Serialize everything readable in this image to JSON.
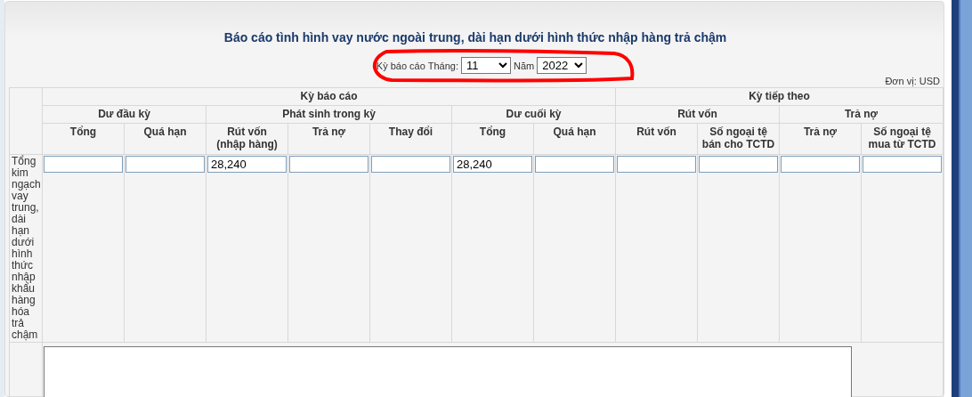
{
  "title": "Báo cáo tình hình vay nước ngoài trung, dài hạn dưới hình thức nhập hàng trả chậm",
  "period": {
    "month_label": "Kỳ báo cáo Tháng:",
    "month": "11",
    "year_label": "Năm",
    "year": "2022"
  },
  "unit": "Đơn vị: USD",
  "table": {
    "groups": [
      {
        "label": "Kỳ báo cáo",
        "subgroups": [
          {
            "label": "Dư đầu kỳ",
            "columns": [
              "Tổng",
              "Quá hạn"
            ]
          },
          {
            "label": "Phát sinh trong kỳ",
            "columns": [
              "Rút vốn\n(nhập hàng)",
              "Trả nợ",
              "Thay đổi"
            ]
          },
          {
            "label": "Dư cuối kỳ",
            "columns": [
              "Tổng",
              "Quá hạn"
            ]
          }
        ]
      },
      {
        "label": "Kỳ tiếp theo",
        "subgroups": [
          {
            "label": "Rút vốn",
            "columns": [
              "Rút vốn",
              "Số ngoại tệ bán cho TCTD"
            ]
          },
          {
            "label": "Trả nợ",
            "columns": [
              "Trả nợ",
              "Số ngoại tệ mua từ TCTD"
            ]
          }
        ]
      }
    ],
    "rows": [
      {
        "label": "Tổng kim ngạch vay trung, dài hạn dưới hình thức nhập khẩu hàng hóa trả chậm",
        "cells": [
          {},
          {},
          {
            "value": "28,240"
          },
          {},
          {},
          {
            "value": "28,240"
          },
          {},
          {},
          {},
          {},
          {}
        ]
      }
    ]
  }
}
